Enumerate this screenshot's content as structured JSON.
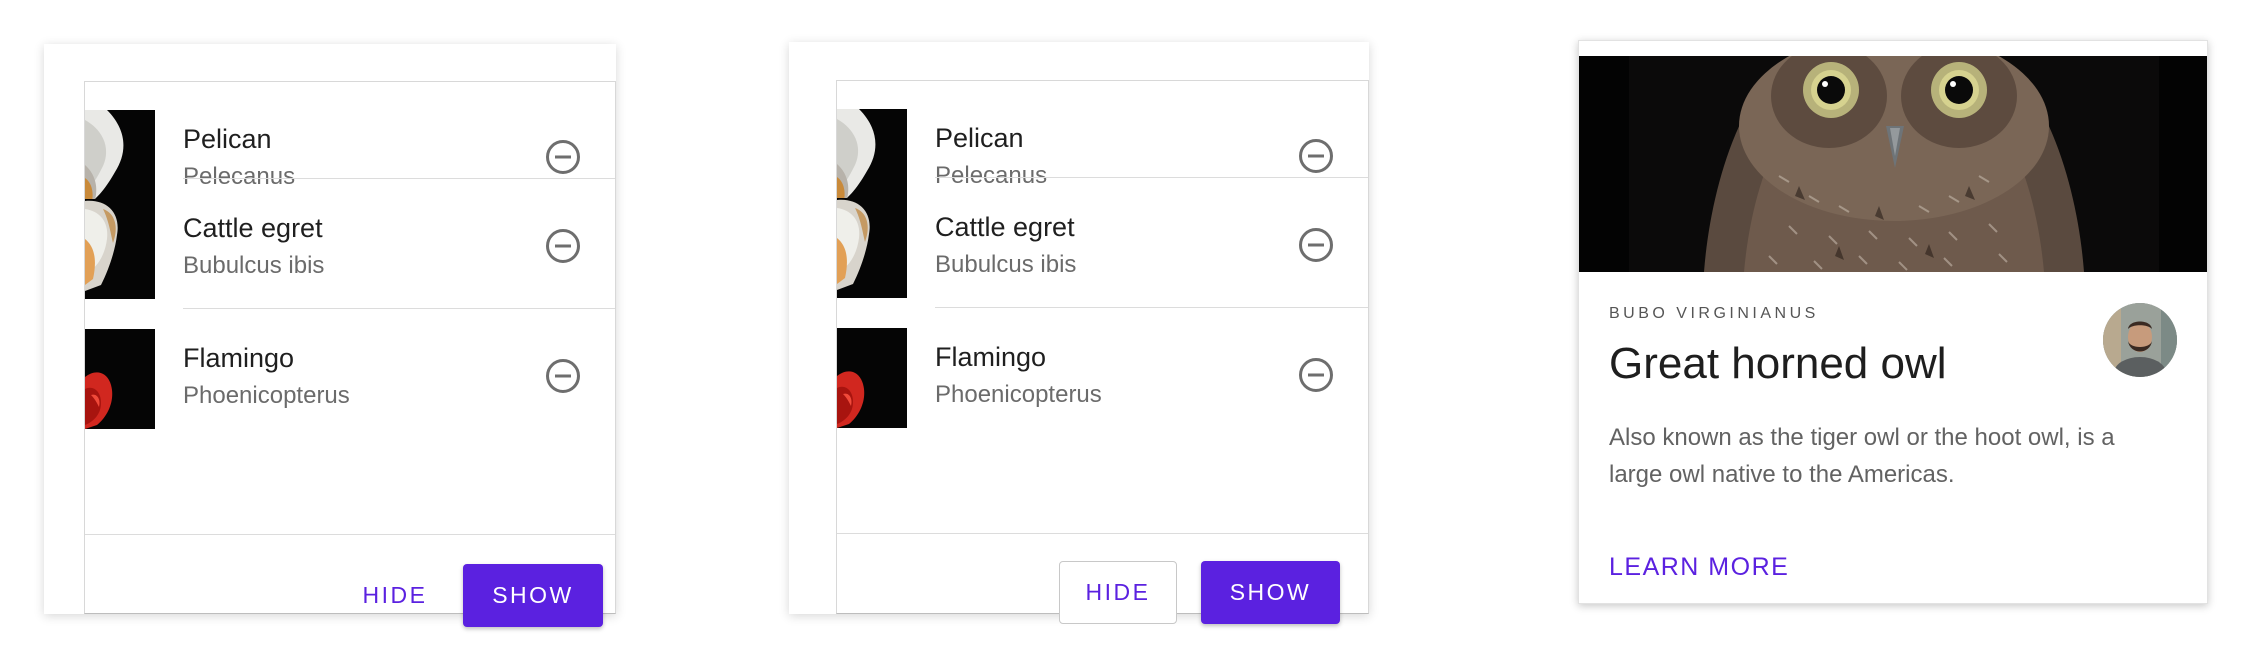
{
  "accent_color": "#5b21e0",
  "list_cards": [
    {
      "birds": [
        {
          "name": "Pelican",
          "latin": "Pelecanus",
          "thumb": "pelican",
          "action_icon": "remove-circle-icon"
        },
        {
          "name": "Cattle egret",
          "latin": "Bubulcus ibis",
          "thumb": "egret",
          "action_icon": "remove-circle-icon"
        },
        {
          "name": "Flamingo",
          "latin": "Phoenicopterus",
          "thumb": "flamingo",
          "action_icon": "remove-circle-icon"
        }
      ],
      "hide_label": "HIDE",
      "show_label": "SHOW",
      "hide_style": "text"
    },
    {
      "birds": [
        {
          "name": "Pelican",
          "latin": "Pelecanus",
          "thumb": "pelican",
          "action_icon": "remove-circle-icon"
        },
        {
          "name": "Cattle egret",
          "latin": "Bubulcus ibis",
          "thumb": "egret",
          "action_icon": "remove-circle-icon"
        },
        {
          "name": "Flamingo",
          "latin": "Phoenicopterus",
          "thumb": "flamingo",
          "action_icon": "remove-circle-icon"
        }
      ],
      "hide_label": "HIDE",
      "show_label": "SHOW",
      "hide_style": "outlined"
    }
  ],
  "owl_card": {
    "overline": "BUBO VIRGINIANUS",
    "title": "Great horned owl",
    "body": "Also known as the tiger owl or the hoot owl, is a large owl native to the Americas.",
    "action_label": "LEARN MORE"
  }
}
